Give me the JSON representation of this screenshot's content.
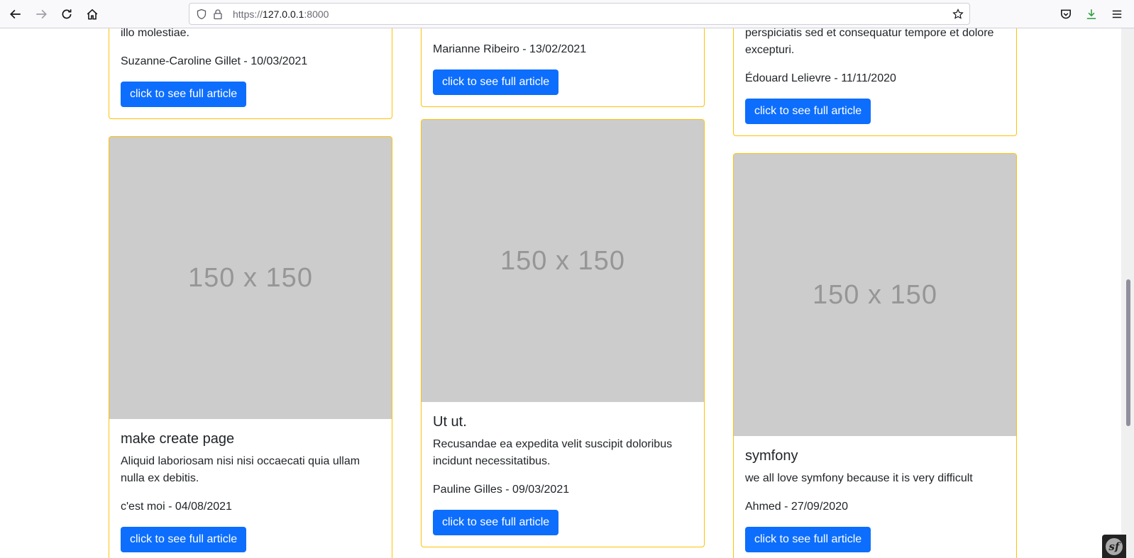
{
  "browser": {
    "url_scheme": "https://",
    "url_host": "127.0.0.1",
    "url_port": ":8000"
  },
  "cards": [
    {
      "partial_text": "illo molestiae.",
      "meta": "Suzanne-Caroline Gillet - 10/03/2021",
      "button": "click to see full article"
    },
    {
      "meta": "Marianne Ribeiro - 13/02/2021",
      "button": "click to see full article"
    },
    {
      "partial_text": "perspiciatis sed et consequatur tempore et dolore excepturi.",
      "meta": "Édouard Lelievre - 11/11/2020",
      "button": "click to see full article"
    },
    {
      "image_label": "150 x 150",
      "title": "make create page",
      "text": "Aliquid laboriosam nisi nisi occaecati quia ullam nulla ex debitis.",
      "meta": "c'est moi - 04/08/2021",
      "button": "click to see full article"
    },
    {
      "image_label": "150 x 150",
      "title": "Ut ut.",
      "text": "Recusandae ea expedita velit suscipit doloribus incidunt necessitatibus.",
      "meta": "Pauline Gilles - 09/03/2021",
      "button": "click to see full article"
    },
    {
      "image_label": "150 x 150",
      "title": "symfony",
      "text": "we all love symfony because it is very difficult",
      "meta": "Ahmed - 27/09/2020",
      "button": "click to see full article"
    }
  ],
  "symfony_toolbar": {
    "icon": "symfony-icon",
    "glyph": "sf"
  },
  "colors": {
    "card_border": "#ffc107",
    "button_bg": "#0d6efd",
    "placeholder_bg": "#cccccc"
  }
}
